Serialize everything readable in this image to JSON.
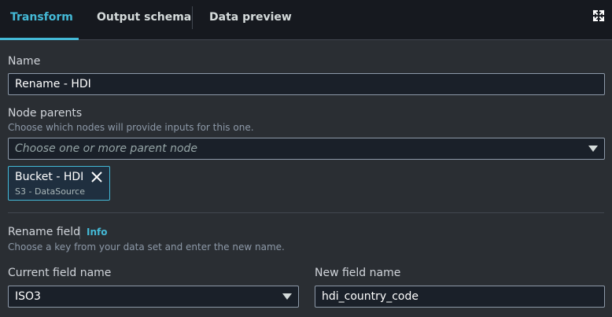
{
  "tabs": [
    {
      "label": "Transform",
      "active": true
    },
    {
      "label": "Output schema",
      "active": false
    },
    {
      "label": "Data preview",
      "active": false
    }
  ],
  "name": {
    "label": "Name",
    "value": "Rename - HDI"
  },
  "node_parents": {
    "label": "Node parents",
    "description": "Choose which nodes will provide inputs for this one.",
    "placeholder": "Choose one or more parent node",
    "selected": [
      {
        "title": "Bucket - HDI",
        "subtitle": "S3 - DataSource"
      }
    ]
  },
  "rename_field": {
    "label": "Rename field",
    "info_label": "Info",
    "description": "Choose a key from your data set and enter the new name.",
    "current_field": {
      "label": "Current field name",
      "value": "ISO3"
    },
    "new_field": {
      "label": "New field name",
      "value": "hdi_country_code"
    }
  },
  "colors": {
    "accent": "#44b9d6",
    "background": "#2a2e33",
    "tab_bar": "#16191f"
  },
  "icons": {
    "expand": "expand-icon",
    "close": "close-icon",
    "dropdown": "caret-down-icon"
  }
}
